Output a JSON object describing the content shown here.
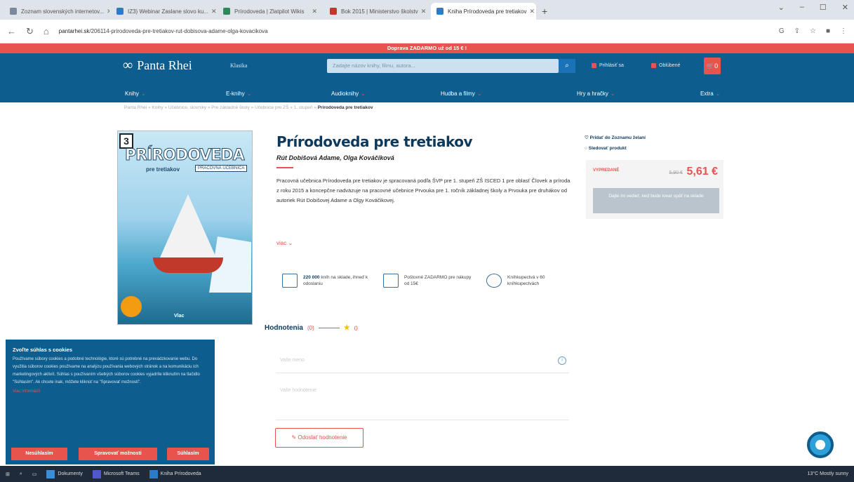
{
  "browser": {
    "tabs": [
      {
        "label": "Zoznam slovenských internetov...",
        "color": "#7a8a9c"
      },
      {
        "label": "IZ3) Webinar Zaslane slovo ku...",
        "color": "#2b7bc8"
      },
      {
        "label": "Prírodoveda | Zlatpilot Wikis",
        "color": "#2e8b57"
      },
      {
        "label": "Bok 2015 | Ministerstvo školstv",
        "color": "#c0392b"
      },
      {
        "label": "Kniha Prírodoveda pre tretiakov",
        "color": "#2b7bc8"
      }
    ],
    "new_tab": "+",
    "url_host": "pantarhei.sk",
    "url_path": "/206114-prirodoveda-pre-tretiakov-rut-dobisova-adame-olga-kovacikova"
  },
  "promo": "Doprava ZADARMO už od 15 € !",
  "header": {
    "logo": "Panta Rhei",
    "klasika": "Klasika",
    "search_placeholder": "Zadajte názov knihy, filmu, autora...",
    "links": [
      "Prihlásiť sa",
      "Oblúbené"
    ],
    "cart_count": "0",
    "nav": [
      "Knihy",
      "E-knihy",
      "Audioknihy",
      "Hudba a filmy",
      "Hry a hračky",
      "Extra"
    ]
  },
  "breadcrumb": {
    "trail": "Panta Rhei  »  Knihy  »  Učebnice, slovníky  »  Pre základné školy  »  Učebnice pre ZŠ  »  1. stupeň  »",
    "current": "Prírodoveda pre tretiakov"
  },
  "cover": {
    "number": "3",
    "title": "PRÍRODOVEDA",
    "subtitle": "pre tretiakov",
    "tag": "PRACOVNÁ UČEBNICA",
    "publisher": "Vlac"
  },
  "product": {
    "title": "Prírodoveda pre tretiakov",
    "authors": "Rút Dobišová Adame, Olga Kováčiková",
    "description": "Pracovná učebnica Prírodoveda pre tretiakov je spracovaná podľa ŠVP pre 1. stupeň ZŠ ISCED 1 pre oblasť Človek a príroda z roku 2015 a koncepčne nadväzuje na pracovné učebnice Prvouka pre 1. ročník základnej školy a Prvouka pre druhákov od autoriek Rút Dobišovej Adame a Olgy Kováčikovej.",
    "more": "viac",
    "features": [
      {
        "bold": "220 000",
        "text": "kníh na sklade, ihneď k odoslaniu"
      },
      {
        "bold": "",
        "text": "Poštovné ZADARMO pre nákupy od 15€"
      },
      {
        "bold": "",
        "text": "Kníhkupectvá v 60 kníhkupectvách"
      }
    ]
  },
  "sidebar": {
    "wishlist": "Pridať do Zoznamu želaní",
    "follow": "Sledovať produkt",
    "sold_out": "VYPREDANÉ",
    "old_price": "5,90 €",
    "price": "5,61 €",
    "notify_button": "Dajte mi vedieť, keď bude tovar opäť na sklade"
  },
  "ratings": {
    "label": "Hodnotenia",
    "count": "(0)",
    "score": "0",
    "field_placeholder": "Vaše meno",
    "text_placeholder": "Vaše hodnotenie",
    "submit": "Odoslať hodnotenie"
  },
  "cookie": {
    "title": "Zvoľte súhlas s cookies",
    "body": "Používame súbory cookies a podobné technológie, ktoré sú potrebné na prevádzkovanie webu. Do využitia súborov cookies používame na analýzu používania webových stránok a na komunikáciu ich marketingových aktivít. Súhlas s používaním všetkých súborov cookies vyjadríte kliknutím na tlačidlo \"Súhlasím\". Ak chcete inak, môžete kliknúť na \"Spravovať možnosti\".",
    "link": "Viac informácií",
    "buttons": [
      "Nesúhlasím",
      "Spravovať možnosti",
      "Súhlasím"
    ]
  },
  "taskbar": {
    "apps": [
      "Dokumenty",
      "Microsoft Teams",
      "Kniha Prírodoveda"
    ],
    "tray": "13°C Mostly sunny"
  }
}
